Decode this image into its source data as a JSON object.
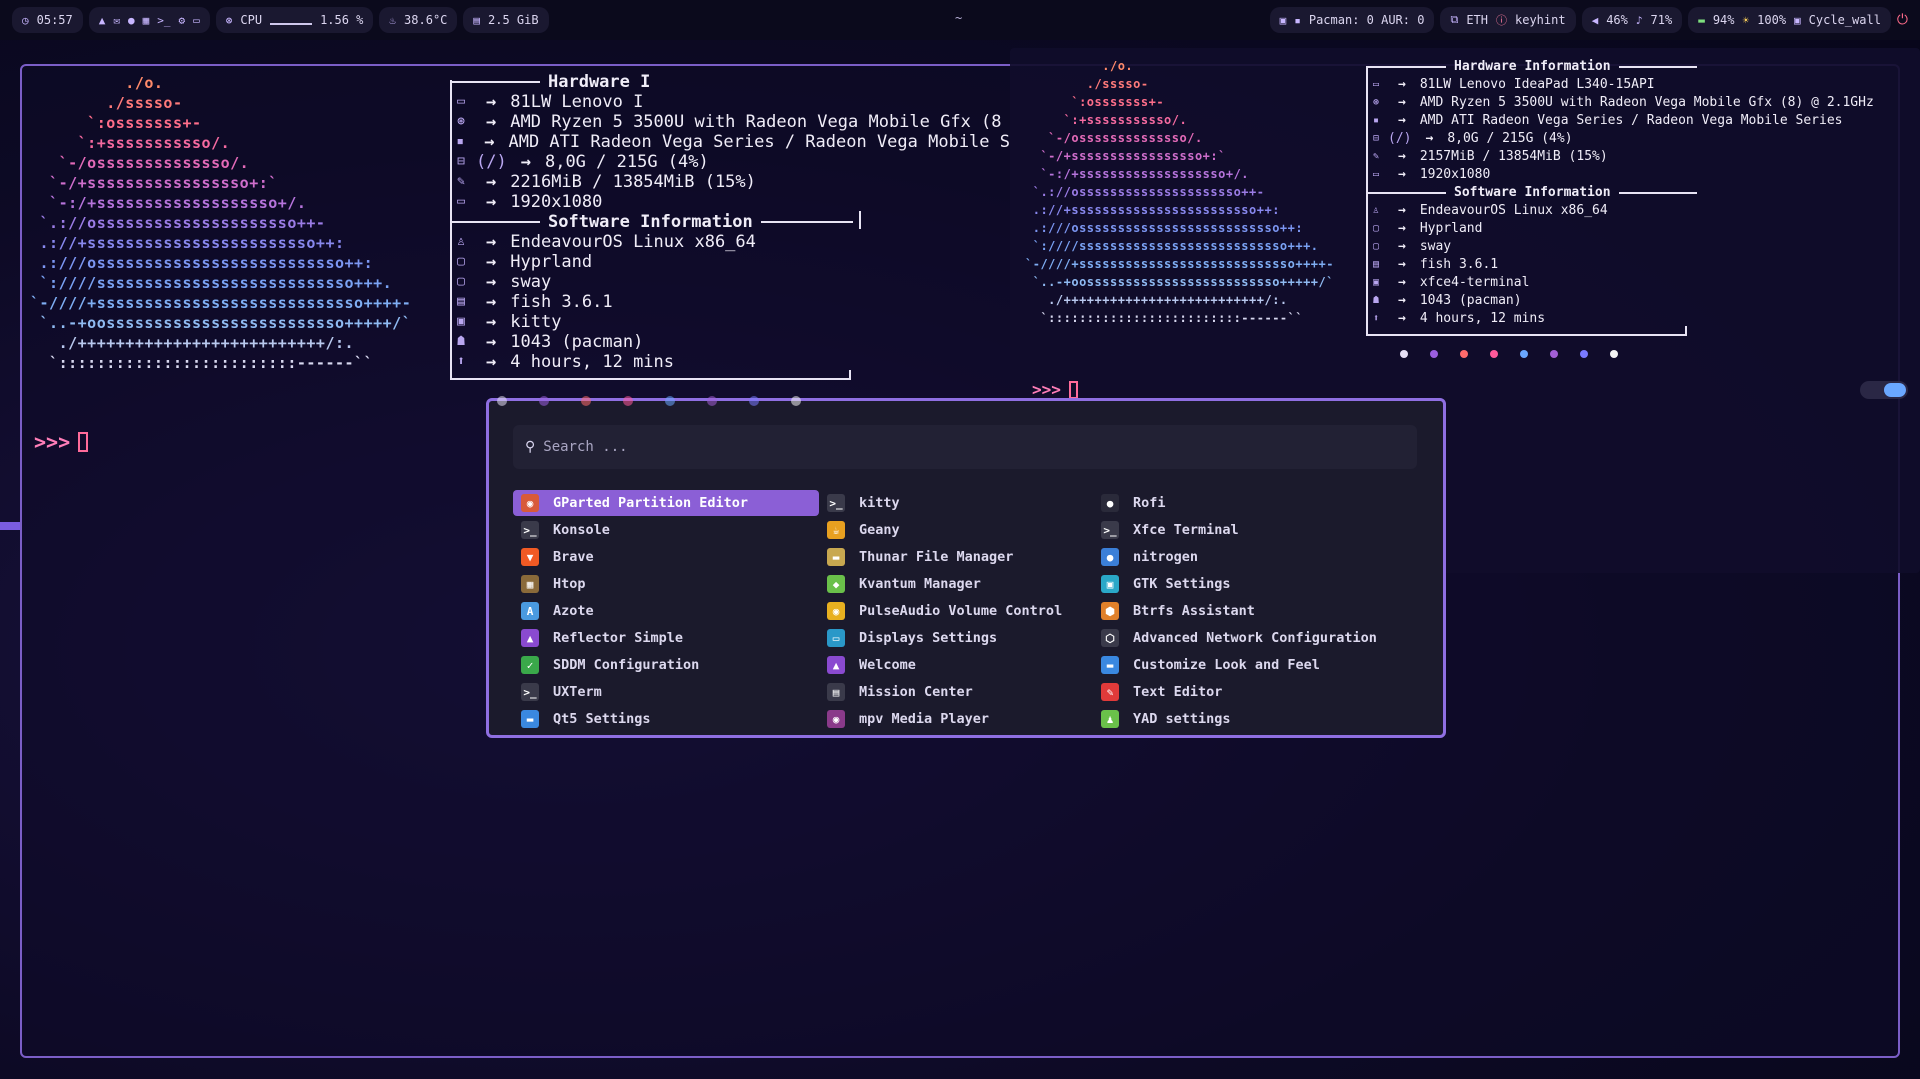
{
  "topbar": {
    "time": "05:57",
    "cpu_label": "CPU",
    "cpu_value": "1.56 %",
    "temp": "38.6°C",
    "mem": "2.5 GiB",
    "center": "~",
    "pacman": "Pacman: 0 AUR: 0",
    "net": "ETH",
    "keyhint": "keyhint",
    "volume": "46%",
    "mic": "71%",
    "battery": "94%",
    "brightness": "100%",
    "wallpaper": "Cycle_wall"
  },
  "left_fetch": {
    "ascii_lines": [
      "          ./o.",
      "        ./sssso-",
      "      `:osssssss+-",
      "     `:+sssssssssso/.",
      "   `-/ossssssssssssso/.",
      "  `-/+sssssssssssssssso+:`",
      "  `-:/+sssssssssssssssssso+/.",
      " `.://osssssssssssssssssssso++-",
      " .://+ssssssssssssssssssssssso++:",
      " .:///ossssssssssssssssssssssssso++:",
      " `:////sssssssssssssssssssssssssso+++.",
      "`-////+ssssssssssssssssssssssssssso++++-",
      " `..-+oosssssssssssssssssssssssso+++++/`",
      "   ./++++++++++++++++++++++++++/:.",
      "  `:::::::::::::::::::::::::------``"
    ],
    "hardware_title": "Hardware I",
    "hardware": [
      "81LW Lenovo I",
      "AMD Ryzen 5 3500U with Radeon Vega Mobile Gfx (8",
      "AMD ATI Radeon Vega Series / Radeon Vega Mobile S",
      "8,0G / 215G (4%)",
      "2216MiB / 13854MiB (15%)",
      "1920x1080"
    ],
    "disk_prefix": "(/)",
    "software_title": "Software Information",
    "software": [
      "EndeavourOS Linux x86_64",
      "Hyprland",
      "sway",
      "fish 3.6.1",
      "kitty",
      "1043 (pacman)",
      "4 hours, 12 mins"
    ],
    "prompt": ">>>"
  },
  "right_fetch": {
    "hardware_title": "Hardware Information",
    "hardware": [
      "81LW Lenovo IdeaPad L340-15API",
      "AMD Ryzen 5 3500U with Radeon Vega Mobile Gfx (8) @ 2.1GHz",
      "AMD ATI Radeon Vega Series / Radeon Vega Mobile Series",
      "8,0G / 215G (4%)",
      "2157MiB / 13854MiB (15%)",
      "1920x1080"
    ],
    "disk_prefix": "(/)",
    "software_title": "Software Information",
    "software": [
      "EndeavourOS Linux x86_64",
      "Hyprland",
      "sway",
      "fish 3.6.1",
      "xfce4-terminal",
      "1043 (pacman)",
      "4 hours, 12 mins"
    ],
    "prompt": ">>>"
  },
  "palette": [
    "#e6e0f5",
    "#9b5fe0",
    "#ff6b6b",
    "#ff5a9a",
    "#6aa7ff",
    "#a25fd6",
    "#7a7aff",
    "#f4f4f4"
  ],
  "rofi": {
    "placeholder": "Search ...",
    "apps": [
      {
        "label": "GParted Partition Editor",
        "icon": "gparted-icon",
        "color": "#d85a3a",
        "glyph": "◉"
      },
      {
        "label": "kitty",
        "icon": "terminal-icon",
        "color": "#3a3a4a",
        "glyph": ">_"
      },
      {
        "label": "Rofi",
        "icon": "rofi-icon",
        "color": "#2a2a3a",
        "glyph": "●"
      },
      {
        "label": "Konsole",
        "icon": "terminal-icon",
        "color": "#3a3a4a",
        "glyph": ">_"
      },
      {
        "label": "Geany",
        "icon": "geany-icon",
        "color": "#e8a020",
        "glyph": "☕"
      },
      {
        "label": "Xfce Terminal",
        "icon": "terminal-icon",
        "color": "#3a3a4a",
        "glyph": ">_"
      },
      {
        "label": "Brave",
        "icon": "brave-icon",
        "color": "#f15a24",
        "glyph": "▼"
      },
      {
        "label": "Thunar File Manager",
        "icon": "folder-icon",
        "color": "#c8a850",
        "glyph": "▬"
      },
      {
        "label": "nitrogen",
        "icon": "nitrogen-icon",
        "color": "#3b7fd8",
        "glyph": "●"
      },
      {
        "label": "Htop",
        "icon": "htop-icon",
        "color": "#8a6a3a",
        "glyph": "▦"
      },
      {
        "label": "Kvantum Manager",
        "icon": "kvantum-icon",
        "color": "#6ac04a",
        "glyph": "◆"
      },
      {
        "label": "GTK Settings",
        "icon": "gtk-icon",
        "color": "#2aa8c8",
        "glyph": "▣"
      },
      {
        "label": "Azote",
        "icon": "azote-icon",
        "color": "#4a9ae0",
        "glyph": "A"
      },
      {
        "label": "PulseAudio Volume Control",
        "icon": "speaker-icon",
        "color": "#e8b020",
        "glyph": "◉"
      },
      {
        "label": "Btrfs Assistant",
        "icon": "btrfs-icon",
        "color": "#e0802a",
        "glyph": "⬢"
      },
      {
        "label": "Reflector Simple",
        "icon": "endeavour-icon",
        "color": "#8a4ad0",
        "glyph": "▲"
      },
      {
        "label": "Displays Settings",
        "icon": "display-icon",
        "color": "#2a98c8",
        "glyph": "▭"
      },
      {
        "label": "Advanced Network Configuration",
        "icon": "network-icon",
        "color": "#3a3a4a",
        "glyph": "⬡"
      },
      {
        "label": "SDDM Configuration",
        "icon": "check-icon",
        "color": "#3aa84a",
        "glyph": "✓"
      },
      {
        "label": "Welcome",
        "icon": "endeavour-icon",
        "color": "#8a4ad0",
        "glyph": "▲"
      },
      {
        "label": "Customize Look and Feel",
        "icon": "appearance-icon",
        "color": "#3a88e0",
        "glyph": "▬"
      },
      {
        "label": "UXTerm",
        "icon": "terminal-icon",
        "color": "#3a3a4a",
        "glyph": ">_"
      },
      {
        "label": "Mission Center",
        "icon": "mission-center-icon",
        "color": "#3a3a4a",
        "glyph": "▤"
      },
      {
        "label": "Text Editor",
        "icon": "pencil-icon",
        "color": "#e03a3a",
        "glyph": "✎"
      },
      {
        "label": "Qt5 Settings",
        "icon": "qt-icon",
        "color": "#3a88e0",
        "glyph": "▬"
      },
      {
        "label": "mpv Media Player",
        "icon": "mpv-icon",
        "color": "#8a3a8a",
        "glyph": "◉"
      },
      {
        "label": "YAD settings",
        "icon": "yad-icon",
        "color": "#6ac04a",
        "glyph": "♟"
      }
    ]
  }
}
